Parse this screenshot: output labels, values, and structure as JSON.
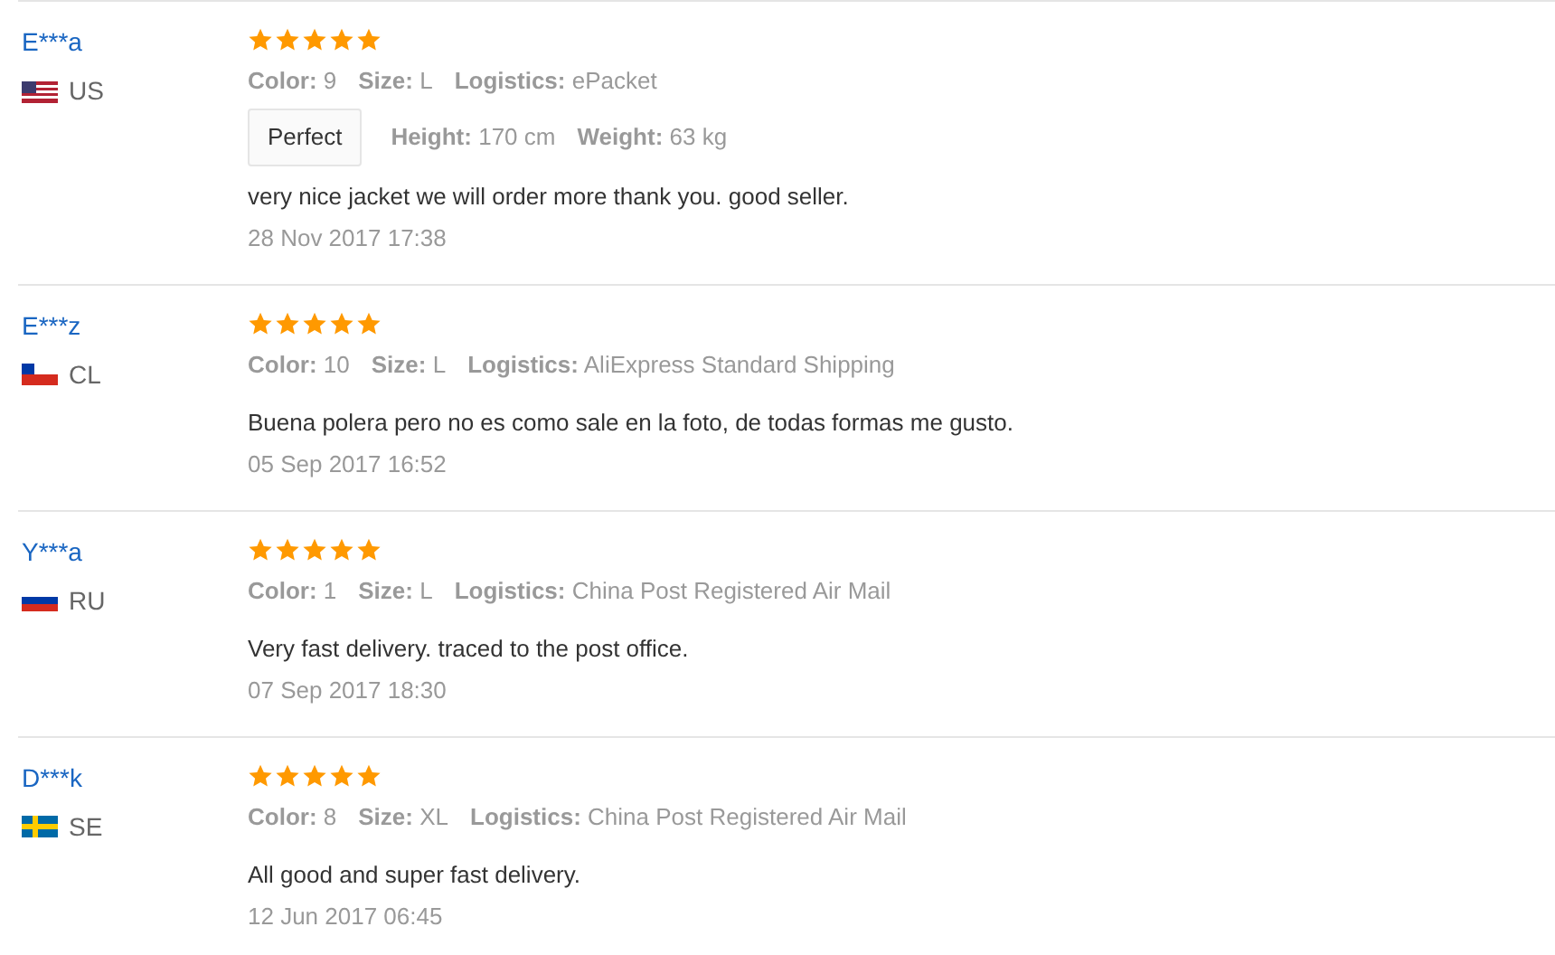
{
  "reviews": [
    {
      "user": "E***a",
      "country": "US",
      "stars": 5,
      "attributes": [
        {
          "label": "Color:",
          "value": "9"
        },
        {
          "label": "Size:",
          "value": "L"
        },
        {
          "label": "Logistics:",
          "value": "ePacket"
        }
      ],
      "fit": {
        "tag": "Perfect",
        "attributes": [
          {
            "label": "Height:",
            "value": "170 cm"
          },
          {
            "label": "Weight:",
            "value": "63 kg"
          }
        ]
      },
      "comment": "very nice jacket we will order more thank you. good seller.",
      "date": "28 Nov 2017 17:38"
    },
    {
      "user": "E***z",
      "country": "CL",
      "stars": 5,
      "attributes": [
        {
          "label": "Color:",
          "value": "10"
        },
        {
          "label": "Size:",
          "value": "L"
        },
        {
          "label": "Logistics:",
          "value": "AliExpress Standard Shipping"
        }
      ],
      "comment": "Buena polera pero no es como sale en la foto, de todas formas me gusto.",
      "date": "05 Sep 2017 16:52"
    },
    {
      "user": "Y***a",
      "country": "RU",
      "stars": 5,
      "attributes": [
        {
          "label": "Color:",
          "value": "1"
        },
        {
          "label": "Size:",
          "value": "L"
        },
        {
          "label": "Logistics:",
          "value": "China Post Registered Air Mail"
        }
      ],
      "comment": "Very fast delivery. traced to the post office.",
      "date": "07 Sep 2017 18:30"
    },
    {
      "user": "D***k",
      "country": "SE",
      "stars": 5,
      "attributes": [
        {
          "label": "Color:",
          "value": "8"
        },
        {
          "label": "Size:",
          "value": "XL"
        },
        {
          "label": "Logistics:",
          "value": "China Post Registered Air Mail"
        }
      ],
      "comment": "All good and super fast delivery.",
      "date": "12 Jun 2017 06:45"
    }
  ]
}
